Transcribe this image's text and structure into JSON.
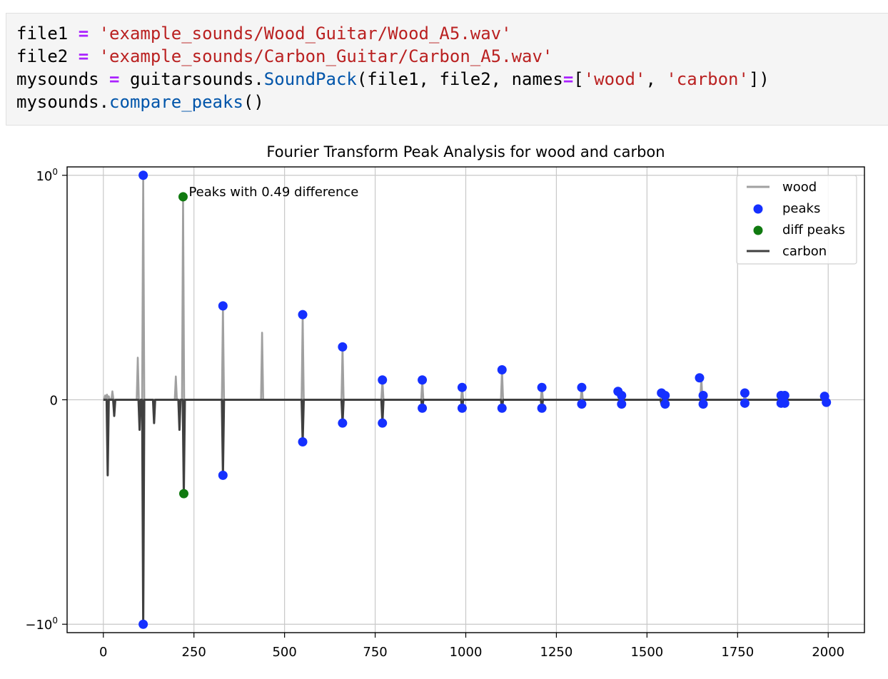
{
  "code": {
    "line1": {
      "var": "file1",
      "op": "=",
      "str": "'example_sounds/Wood_Guitar/Wood_A5.wav'"
    },
    "line2": {
      "var": "file2",
      "op": "=",
      "str": "'example_sounds/Carbon_Guitar/Carbon_A5.wav'"
    },
    "line3": {
      "var": "mysounds",
      "op": "=",
      "mod": "guitarsounds.",
      "fn": "SoundPack",
      "args1": "(file1, file2, names",
      "op2": "=",
      "bracket_open": "[",
      "str1": "'wood'",
      "comma": ", ",
      "str2": "'carbon'",
      "bracket_close": "])"
    },
    "line4": {
      "obj": "mysounds.",
      "fn": "compare_peaks",
      "call": "()"
    }
  },
  "colors": {
    "wood": "#a0a0a0",
    "carbon": "#404040",
    "peaks": "#1530ff",
    "diff_peaks": "#107a10",
    "grid": "#c8c8c8"
  },
  "chart_data": {
    "type": "line",
    "title": "Fourier Transform Peak Analysis for wood and carbon",
    "xlabel": "",
    "ylabel": "",
    "xlim": [
      -100,
      2100
    ],
    "ylim": [
      -1.1,
      1.1
    ],
    "yscale": "symlog",
    "grid": true,
    "legend_position": "top-right",
    "xticks": [
      "0",
      "250",
      "500",
      "750",
      "1000",
      "1250",
      "1500",
      "1750",
      "2000"
    ],
    "xtick_values": [
      0,
      250,
      500,
      750,
      1000,
      1250,
      1500,
      1750,
      2000
    ],
    "yticks": [
      {
        "value": 1,
        "base": "10",
        "exp": "0",
        "sign": ""
      },
      {
        "value": 0,
        "base": "0",
        "exp": "",
        "sign": ""
      },
      {
        "value": -1,
        "base": "10",
        "exp": "0",
        "sign": "−"
      }
    ],
    "legend": [
      {
        "label": "wood",
        "kind": "line",
        "color": "#a0a0a0"
      },
      {
        "label": "peaks",
        "kind": "dot",
        "color": "#1530ff"
      },
      {
        "label": "diff peaks",
        "kind": "dot",
        "color": "#107a10"
      },
      {
        "label": "carbon",
        "kind": "line",
        "color": "#404040"
      }
    ],
    "annotation": {
      "text": "Peaks with 0.49 difference",
      "x": 220,
      "y": 0.78
    },
    "series": [
      {
        "name": "wood",
        "spikes": [
          {
            "x": 5,
            "y": 0.005
          },
          {
            "x": 10,
            "y": 0.006
          },
          {
            "x": 15,
            "y": 0.004
          },
          {
            "x": 25,
            "y": 0.01
          },
          {
            "x": 95,
            "y": 0.06
          },
          {
            "x": 110,
            "y": 1.0
          },
          {
            "x": 200,
            "y": 0.03
          },
          {
            "x": 220,
            "y": 0.78
          },
          {
            "x": 330,
            "y": 0.18
          },
          {
            "x": 438,
            "y": 0.11
          },
          {
            "x": 550,
            "y": 0.155
          },
          {
            "x": 660,
            "y": 0.08
          },
          {
            "x": 770,
            "y": 0.025
          },
          {
            "x": 880,
            "y": 0.025
          },
          {
            "x": 990,
            "y": 0.015
          },
          {
            "x": 1100,
            "y": 0.04
          },
          {
            "x": 1210,
            "y": 0.015
          },
          {
            "x": 1320,
            "y": 0.015
          },
          {
            "x": 1430,
            "y": 0.01
          },
          {
            "x": 1540,
            "y": 0.008
          },
          {
            "x": 1650,
            "y": 0.028
          },
          {
            "x": 1770,
            "y": 0.008
          },
          {
            "x": 1870,
            "y": 0.005
          },
          {
            "x": 1880,
            "y": 0.005
          },
          {
            "x": 1990,
            "y": 0.004
          }
        ]
      },
      {
        "name": "carbon",
        "spikes": [
          {
            "x": 12,
            "y": -0.13
          },
          {
            "x": 30,
            "y": -0.02
          },
          {
            "x": 100,
            "y": -0.04
          },
          {
            "x": 110,
            "y": -1.0
          },
          {
            "x": 140,
            "y": -0.03
          },
          {
            "x": 210,
            "y": -0.04
          },
          {
            "x": 222,
            "y": -0.18
          },
          {
            "x": 330,
            "y": -0.13
          },
          {
            "x": 550,
            "y": -0.06
          },
          {
            "x": 660,
            "y": -0.03
          },
          {
            "x": 770,
            "y": -0.03
          },
          {
            "x": 880,
            "y": -0.01
          },
          {
            "x": 990,
            "y": -0.01
          },
          {
            "x": 1100,
            "y": -0.01
          },
          {
            "x": 1210,
            "y": -0.01
          },
          {
            "x": 1320,
            "y": -0.005
          },
          {
            "x": 1430,
            "y": -0.005
          },
          {
            "x": 1540,
            "y": -0.005
          },
          {
            "x": 1650,
            "y": -0.005
          },
          {
            "x": 1770,
            "y": -0.004
          },
          {
            "x": 1870,
            "y": -0.004
          },
          {
            "x": 1880,
            "y": -0.004
          },
          {
            "x": 1990,
            "y": -0.003
          }
        ]
      }
    ],
    "peaks": [
      {
        "x": 110,
        "y": 1.0
      },
      {
        "x": 330,
        "y": 0.18
      },
      {
        "x": 550,
        "y": 0.155
      },
      {
        "x": 660,
        "y": 0.08
      },
      {
        "x": 770,
        "y": 0.025
      },
      {
        "x": 880,
        "y": 0.025
      },
      {
        "x": 990,
        "y": 0.015
      },
      {
        "x": 1100,
        "y": 0.04
      },
      {
        "x": 1210,
        "y": 0.015
      },
      {
        "x": 1320,
        "y": 0.015
      },
      {
        "x": 1420,
        "y": 0.01
      },
      {
        "x": 1430,
        "y": 0.005
      },
      {
        "x": 1540,
        "y": 0.008
      },
      {
        "x": 1550,
        "y": 0.005
      },
      {
        "x": 1645,
        "y": 0.028
      },
      {
        "x": 1655,
        "y": 0.005
      },
      {
        "x": 1770,
        "y": 0.008
      },
      {
        "x": 1870,
        "y": 0.005
      },
      {
        "x": 1880,
        "y": 0.005
      },
      {
        "x": 1990,
        "y": 0.004
      },
      {
        "x": 110,
        "y": -1.0
      },
      {
        "x": 330,
        "y": -0.13
      },
      {
        "x": 550,
        "y": -0.06
      },
      {
        "x": 660,
        "y": -0.03
      },
      {
        "x": 770,
        "y": -0.03
      },
      {
        "x": 880,
        "y": -0.01
      },
      {
        "x": 990,
        "y": -0.01
      },
      {
        "x": 1100,
        "y": -0.01
      },
      {
        "x": 1210,
        "y": -0.01
      },
      {
        "x": 1320,
        "y": -0.005
      },
      {
        "x": 1430,
        "y": -0.005
      },
      {
        "x": 1550,
        "y": -0.005
      },
      {
        "x": 1655,
        "y": -0.005
      },
      {
        "x": 1770,
        "y": -0.004
      },
      {
        "x": 1870,
        "y": -0.004
      },
      {
        "x": 1880,
        "y": -0.004
      },
      {
        "x": 1995,
        "y": -0.003
      }
    ],
    "diff_peaks": [
      {
        "x": 220,
        "y": 0.78
      },
      {
        "x": 222,
        "y": -0.18
      }
    ]
  }
}
